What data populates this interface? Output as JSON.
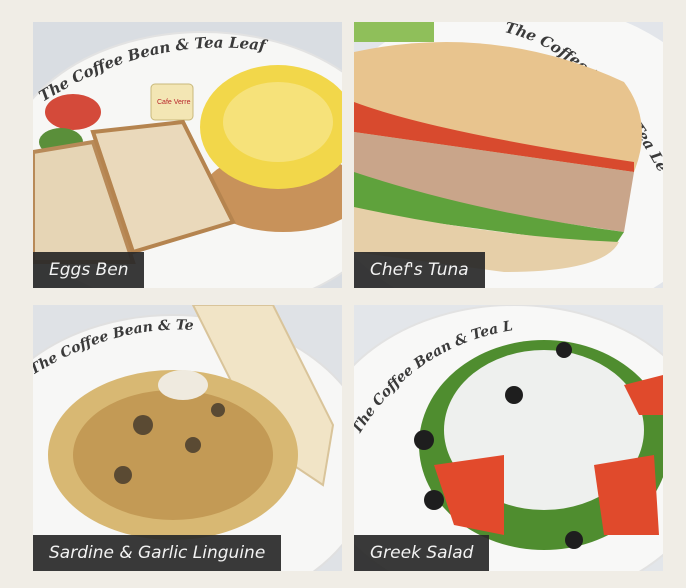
{
  "menu_items": [
    {
      "name": "Eggs Ben",
      "image_text": "The Coffee Bean & Tea Leaf",
      "packet_label": "Cafe Verre"
    },
    {
      "name": "Chef's Tuna",
      "image_text": "The Coffee Bean & Tea Leaf"
    },
    {
      "name": "Sardine & Garlic Linguine",
      "image_text": "The Coffee Bean & Tea Leaf"
    },
    {
      "name": "Greek Salad",
      "image_text": "The Coffee Bean & Tea Leaf"
    }
  ]
}
